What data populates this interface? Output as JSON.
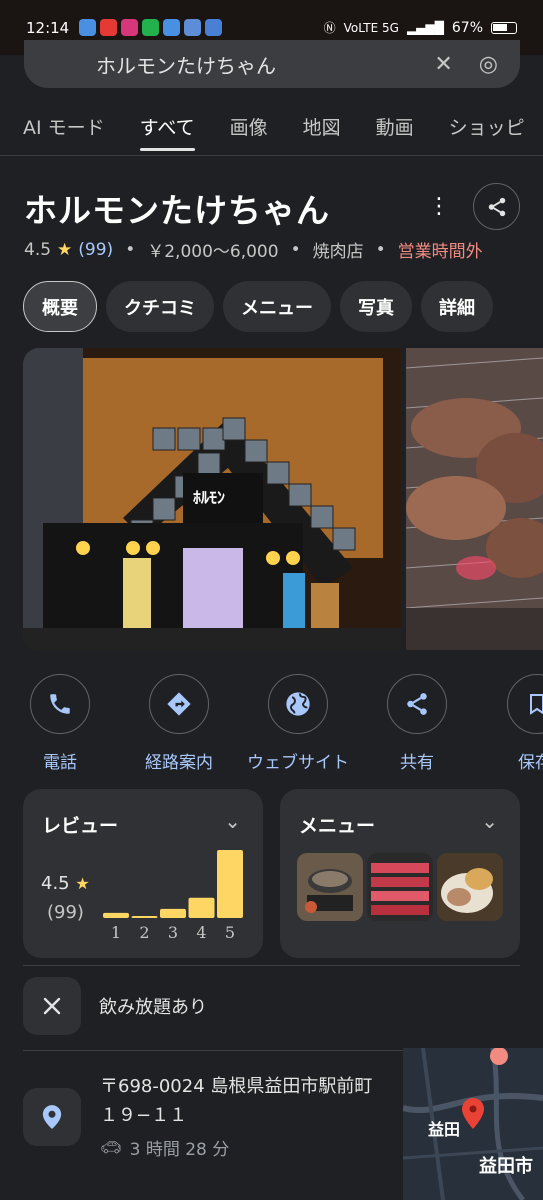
{
  "status_bar": {
    "time": "12:14",
    "network": "VoLTE 5G",
    "battery": "67%"
  },
  "search": {
    "query": "ホルモンたけちゃん"
  },
  "tabs": [
    "AI モード",
    "すべて",
    "画像",
    "地図",
    "動画",
    "ショッピ"
  ],
  "active_tab": "すべて",
  "place": {
    "name": "ホルモンたけちゃん",
    "rating": "4.5",
    "review_count": "(99)",
    "price": "￥2,000～6,000",
    "category": "焼肉店",
    "status": "営業時間外"
  },
  "chips": [
    "概要",
    "クチコミ",
    "メニュー",
    "写真",
    "詳細"
  ],
  "actions": [
    "電話",
    "経路案内",
    "ウェブサイト",
    "共有",
    "保存"
  ],
  "review_card": {
    "title": "レビュー",
    "score": "4.5",
    "count": "(99)"
  },
  "chart_data": {
    "type": "bar",
    "categories": [
      "1",
      "2",
      "3",
      "4",
      "5"
    ],
    "values": [
      5,
      2,
      9,
      20,
      67
    ],
    "title": "",
    "xlabel": "",
    "ylabel": ""
  },
  "menu_card": {
    "title": "メニュー"
  },
  "amenity": {
    "label": "飲み放題あり"
  },
  "address": {
    "text": "〒698-0024 島根県益田市駅前町１９−１１",
    "drive_time": "3 時間 28 分"
  },
  "map": {
    "label_1": "益田",
    "label_2": "益田市"
  },
  "colors": {
    "accent_blue": "#a8c7fa",
    "star_yellow": "#fdd663",
    "closed_red": "#f28b82",
    "bar_yellow": "#fdd663"
  }
}
